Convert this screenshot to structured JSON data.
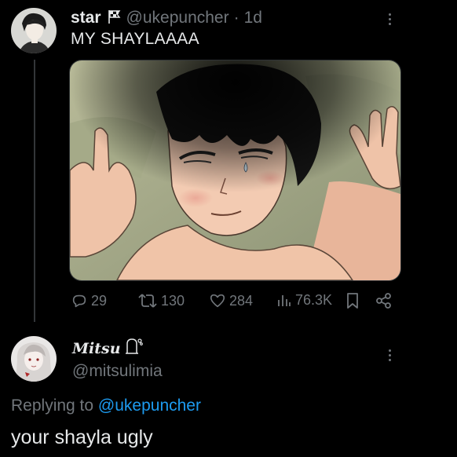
{
  "tweet": {
    "author_name": "star",
    "flag_icon": "flag-icon",
    "handle": "@ukepuncher",
    "separator": "·",
    "time": "1d",
    "text": "MY SHAYLAAAA",
    "media_alt_icon": "manga-illustration",
    "stats": {
      "replies": "29",
      "retweets": "130",
      "likes": "284",
      "views": "76.3K"
    }
  },
  "reply": {
    "author_name": "Mitsu",
    "handle": "@mitsulimia",
    "replying_prefix": "Replying to",
    "replying_handle": "@ukepuncher",
    "text": "your shayla ugly"
  },
  "colors": {
    "background": "#000000",
    "text": "#e7e9ea",
    "muted": "#71767b",
    "link": "#1d9bf0"
  }
}
